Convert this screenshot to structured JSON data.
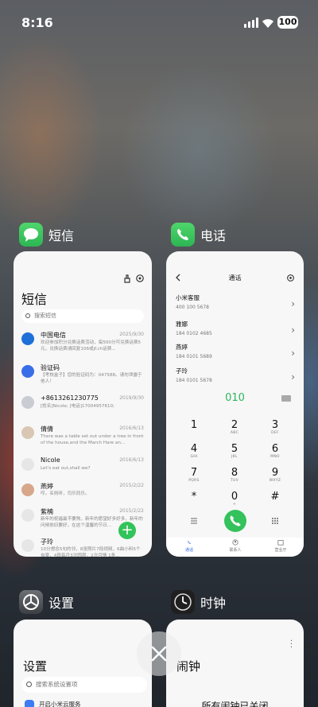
{
  "status_bar": {
    "time": "8:16",
    "battery": "100"
  },
  "apps": {
    "sms": {
      "name": "短信",
      "page_title": "短信",
      "search_placeholder": "搜索短信",
      "messages": [
        {
          "name": "中国电信",
          "date": "2025/9/30",
          "preview": "欢迎参加积分兑换话费活动，每500分可兑换话费5元，兑换话费请回复106或jf.ch话费...",
          "avatar_color": "#1f6fd8"
        },
        {
          "name": "验证码",
          "date": "",
          "preview": "【考核盒子】您的验证码为：047588。请勿泄露于他人！",
          "avatar_color": "#3a6ee8"
        },
        {
          "name": "+8613261230775",
          "date": "2019/9/30",
          "preview": "[姓名]Nicole;\n[电话]17004957610;",
          "avatar_color": "#c9ccd2"
        },
        {
          "name": "倩倩",
          "date": "2016/6/13",
          "preview": "There was a table set out under a tree in front of the house,and the March Hare an...",
          "avatar_color": "#d9c7b4"
        },
        {
          "name": "Nicole",
          "date": "2016/6/13",
          "preview": "Let's eat out,shall we?",
          "avatar_color": "#e6e6e6"
        },
        {
          "name": "燕婷",
          "date": "2015/2/22",
          "preview": "哼。名则听，司乐同乐。",
          "avatar_color": "#d8a68a"
        },
        {
          "name": "紫楠",
          "date": "2015/2/22",
          "preview": "新年的祝福最不要煞，新年的愿望好多好多，新年的问候依旧要好，在这个温馨的节日...",
          "avatar_color": "#e6e6e6"
        },
        {
          "name": "子玲",
          "date": "",
          "preview": "10分想念5句的邻，8张照片7段视频，6曲小料5个自豪，4段每月3次圆恩，2次月情 1条...",
          "avatar_color": "#e6e6e6"
        }
      ]
    },
    "phone": {
      "name": "电话",
      "page_title": "通话",
      "contacts": [
        {
          "name": "小米客服",
          "number": "400 100 5678"
        },
        {
          "name": "雅娜",
          "number": "184 0102 4685"
        },
        {
          "name": "燕婷",
          "number": "184 0101 5689"
        },
        {
          "name": "子玲",
          "number": "184 0101 5678"
        }
      ],
      "dialed": "010",
      "keys": [
        {
          "d": "1",
          "l": ""
        },
        {
          "d": "2",
          "l": "ABC"
        },
        {
          "d": "3",
          "l": "DEF"
        },
        {
          "d": "4",
          "l": "GHI"
        },
        {
          "d": "5",
          "l": "JKL"
        },
        {
          "d": "6",
          "l": "MNO"
        },
        {
          "d": "7",
          "l": "PQRS"
        },
        {
          "d": "8",
          "l": "TUV"
        },
        {
          "d": "9",
          "l": "WXYZ"
        },
        {
          "d": "*",
          "l": ""
        },
        {
          "d": "0",
          "l": "+"
        },
        {
          "d": "#",
          "l": ""
        }
      ],
      "tabs": [
        "通话",
        "联系人",
        "营业厅"
      ]
    },
    "settings": {
      "name": "设置",
      "page_title": "设置",
      "search_placeholder": "搜索系统设置项",
      "first_row": "开启小米云服务"
    },
    "clock": {
      "name": "时钟",
      "page_title": "闹钟",
      "empty_text": "所有闹钟已关闭"
    }
  },
  "colors": {
    "accent_green": "#33c25c",
    "link_blue": "#3a6ee8"
  }
}
